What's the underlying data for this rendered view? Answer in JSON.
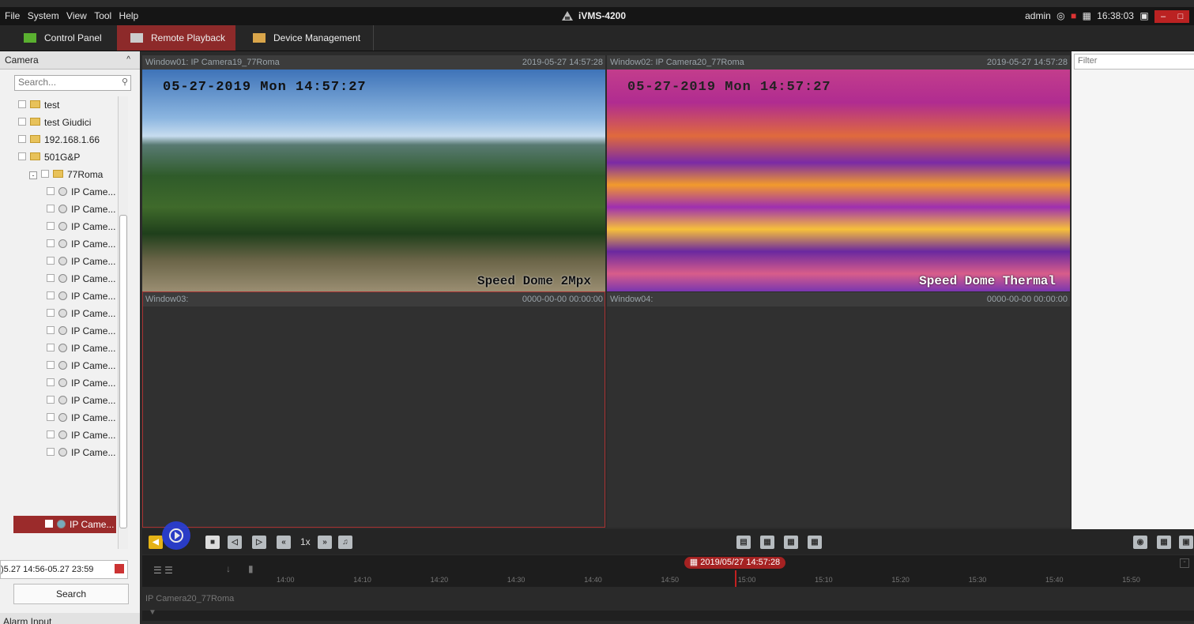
{
  "menu": [
    "File",
    "System",
    "View",
    "Tool",
    "Help"
  ],
  "app_title": "iVMS-4200",
  "status": {
    "user": "admin",
    "clock": "16:38:03"
  },
  "tabs": [
    {
      "label": "Control Panel",
      "active": false
    },
    {
      "label": "Remote Playback",
      "active": true
    },
    {
      "label": "Device Management",
      "active": false
    }
  ],
  "left": {
    "header": "Camera",
    "search_placeholder": "Search...",
    "tree": [
      {
        "label": "test",
        "type": "folder",
        "indent": 1
      },
      {
        "label": "test Giudici",
        "type": "folder",
        "indent": 1
      },
      {
        "label": "192.168.1.66",
        "type": "folder",
        "indent": 1
      },
      {
        "label": "501G&P",
        "type": "folder",
        "indent": 1
      },
      {
        "label": "77Roma",
        "type": "folder",
        "indent": 0,
        "expanded": true
      },
      {
        "label": "IP Came...",
        "type": "camera",
        "indent": 2
      },
      {
        "label": "IP Came...",
        "type": "camera",
        "indent": 2
      },
      {
        "label": "IP Came...",
        "type": "camera",
        "indent": 2
      },
      {
        "label": "IP Came...",
        "type": "camera",
        "indent": 2
      },
      {
        "label": "IP Came...",
        "type": "camera",
        "indent": 2
      },
      {
        "label": "IP Came...",
        "type": "camera",
        "indent": 2
      },
      {
        "label": "IP Came...",
        "type": "camera",
        "indent": 2
      },
      {
        "label": "IP Came...",
        "type": "camera",
        "indent": 2
      },
      {
        "label": "IP Came...",
        "type": "camera",
        "indent": 2
      },
      {
        "label": "IP Came...",
        "type": "camera",
        "indent": 2
      },
      {
        "label": "IP Came...",
        "type": "camera",
        "indent": 2
      },
      {
        "label": "IP Came...",
        "type": "camera",
        "indent": 2
      },
      {
        "label": "IP Came...",
        "type": "camera",
        "indent": 2
      },
      {
        "label": "IP Came...",
        "type": "camera",
        "indent": 2
      },
      {
        "label": "IP Came...",
        "type": "camera",
        "indent": 2
      },
      {
        "label": "IP Came...",
        "type": "camera",
        "indent": 2
      }
    ],
    "selected": "IP Came...",
    "time_range": ")5.27 14:56-05.27 23:59",
    "search_button": "Search",
    "alarm_header": "Alarm Input"
  },
  "windows": [
    {
      "title": "Window01: IP Camera19_77Roma",
      "time": "2019-05-27 14:57:28",
      "osd": "05-27-2019 Mon 14:57:27",
      "overlay": "Speed Dome 2Mpx"
    },
    {
      "title": "Window02: IP Camera20_77Roma",
      "time": "2019-05-27 14:57:28",
      "osd": "05-27-2019 Mon 14:57:27",
      "overlay": "Speed Dome Thermal"
    },
    {
      "title": "Window03:",
      "time": "0000-00-00 00:00:00"
    },
    {
      "title": "Window04:",
      "time": "0000-00-00 00:00:00"
    }
  ],
  "filter_placeholder": "Filter",
  "controls": {
    "speed": "1x"
  },
  "timeline": {
    "current": "2019/05/27 14:57:28",
    "ticks": [
      "14:00",
      "14:10",
      "14:20",
      "14:30",
      "14:40",
      "14:50",
      "15:00",
      "15:10",
      "15:20",
      "15:30",
      "15:40",
      "15:50"
    ],
    "label": "IP Camera20_77Roma"
  }
}
